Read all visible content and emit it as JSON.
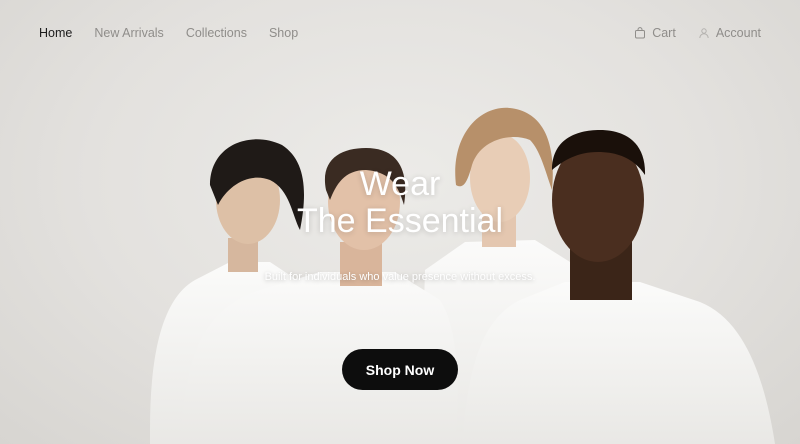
{
  "nav": {
    "links": [
      {
        "label": "Home",
        "active": true
      },
      {
        "label": "New Arrivals",
        "active": false
      },
      {
        "label": "Collections",
        "active": false
      },
      {
        "label": "Shop",
        "active": false
      }
    ],
    "cart": {
      "label": "Cart",
      "icon": "bag-icon"
    },
    "account": {
      "label": "Account",
      "icon": "user-icon"
    }
  },
  "hero": {
    "headline_line1": "Wear",
    "headline_line2": "The Essential",
    "subheadline": "Built for individuals who value presence without excess.",
    "cta_label": "Shop Now"
  },
  "colors": {
    "background": "#e6e4e1",
    "nav_active": "#1c1c1c",
    "nav_inactive": "#8f8d8a",
    "cta_background": "#0d0d0d",
    "cta_text": "#ffffff"
  }
}
